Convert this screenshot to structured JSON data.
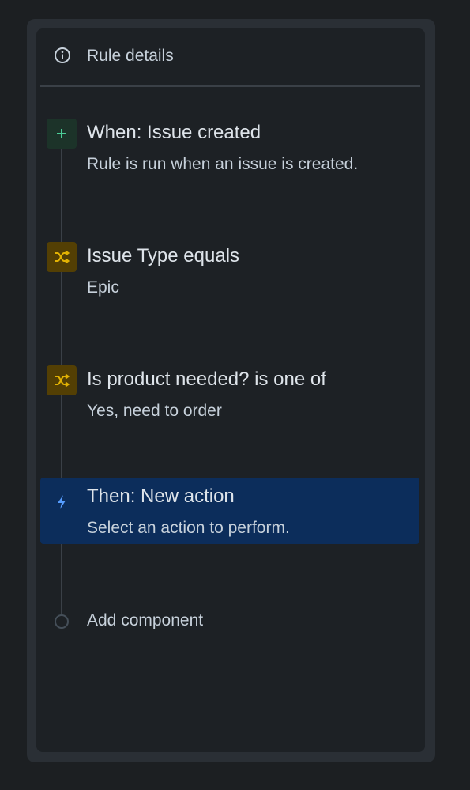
{
  "panel": {
    "title": "Rule details",
    "title_icon": "info-icon"
  },
  "steps": [
    {
      "kind": "trigger",
      "icon": "plus-icon",
      "icon_color": "#4bce97",
      "icon_bg": "#1c3329",
      "title": "When: Issue created",
      "description": "Rule is run when an issue is created."
    },
    {
      "kind": "condition",
      "icon": "shuffle-icon",
      "icon_color": "#e2b203",
      "icon_bg": "#533f04",
      "title": "Issue Type equals",
      "description": "Epic"
    },
    {
      "kind": "condition",
      "icon": "shuffle-icon",
      "icon_color": "#e2b203",
      "icon_bg": "#533f04",
      "title": "Is product needed? is one of",
      "description": "Yes, need to order"
    },
    {
      "kind": "action",
      "icon": "lightning-icon",
      "icon_color": "#579dff",
      "selected": true,
      "selected_bg": "#0c2d5b",
      "title": "Then: New action",
      "description": "Select an action to perform."
    }
  ],
  "add_component": {
    "label": "Add component"
  }
}
